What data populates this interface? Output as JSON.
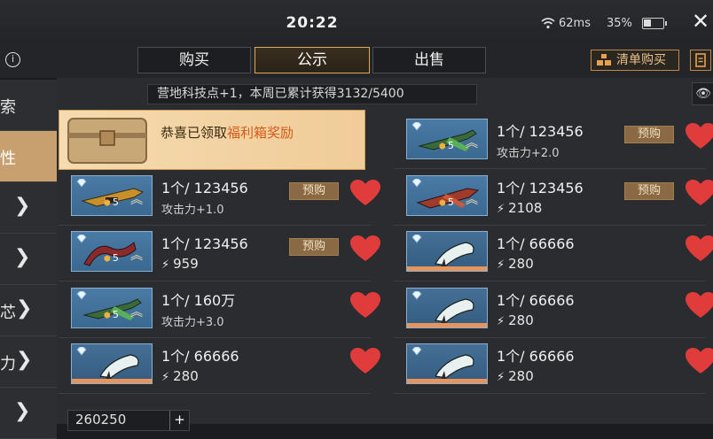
{
  "status": {
    "time": "20:22",
    "ping": "62ms",
    "battery": "35%"
  },
  "tabs": [
    "购买",
    "公示",
    "出售"
  ],
  "active_tab": 1,
  "clear_button": "清单购买",
  "sidebar": {
    "items": [
      {
        "label": "索",
        "has_chevron": false,
        "active": false
      },
      {
        "label": "性",
        "has_chevron": false,
        "active": true
      },
      {
        "label": "",
        "has_chevron": true,
        "active": false
      },
      {
        "label": "",
        "has_chevron": true,
        "active": false
      },
      {
        "label": "芯",
        "has_chevron": true,
        "active": false
      },
      {
        "label": "力",
        "has_chevron": true,
        "active": false
      },
      {
        "label": "",
        "has_chevron": true,
        "active": false
      }
    ]
  },
  "notice": "营地科技点+1，本周已累计获得3132/5400",
  "notice_overlay": "关注",
  "banner": {
    "prefix": "恭喜已领取",
    "highlight": "福利箱奖励"
  },
  "items": [
    {
      "price": "1个/ 123456",
      "sub": "攻击力+2.0",
      "sub_is_number": false,
      "preorder": "预购",
      "level": "5",
      "weapon": "green-rifle",
      "column": 1,
      "row": 0
    },
    {
      "price": "1个/ 123456",
      "sub": "攻击力+1.0",
      "sub_is_number": false,
      "preorder": "预购",
      "level": "5",
      "weapon": "gold-rifle",
      "column": 0,
      "row": 1
    },
    {
      "price": "1个/ 123456",
      "sub": "2108",
      "sub_is_number": true,
      "preorder": "预购",
      "level": "5",
      "weapon": "red-rifle",
      "column": 1,
      "row": 1
    },
    {
      "price": "1个/ 123456",
      "sub": "959",
      "sub_is_number": true,
      "preorder": "预购",
      "level": "5",
      "weapon": "red-claw",
      "column": 0,
      "row": 2
    },
    {
      "price": "1个/ 66666",
      "sub": "280",
      "sub_is_number": true,
      "preorder": "",
      "level": "",
      "weapon": "plain-blade",
      "column": 1,
      "row": 2
    },
    {
      "price": "1个/ 160万",
      "sub": "攻击力+3.0",
      "sub_is_number": false,
      "preorder": "",
      "level": "5",
      "weapon": "green-rifle",
      "column": 0,
      "row": 3
    },
    {
      "price": "1个/ 66666",
      "sub": "280",
      "sub_is_number": true,
      "preorder": "",
      "level": "",
      "weapon": "plain-blade",
      "column": 1,
      "row": 3
    },
    {
      "price": "1个/ 66666",
      "sub": "280",
      "sub_is_number": true,
      "preorder": "",
      "level": "",
      "weapon": "plain-blade",
      "column": 0,
      "row": 4
    },
    {
      "price": "1个/ 66666",
      "sub": "280",
      "sub_is_number": true,
      "preorder": "",
      "level": "",
      "weapon": "plain-blade",
      "column": 1,
      "row": 4
    }
  ],
  "bottom_money": "260250",
  "colors": {
    "accent": "#e0a85a",
    "heart": "#e03c3c",
    "banner": "#f5dbb0",
    "preorder": "#8a6a44"
  }
}
